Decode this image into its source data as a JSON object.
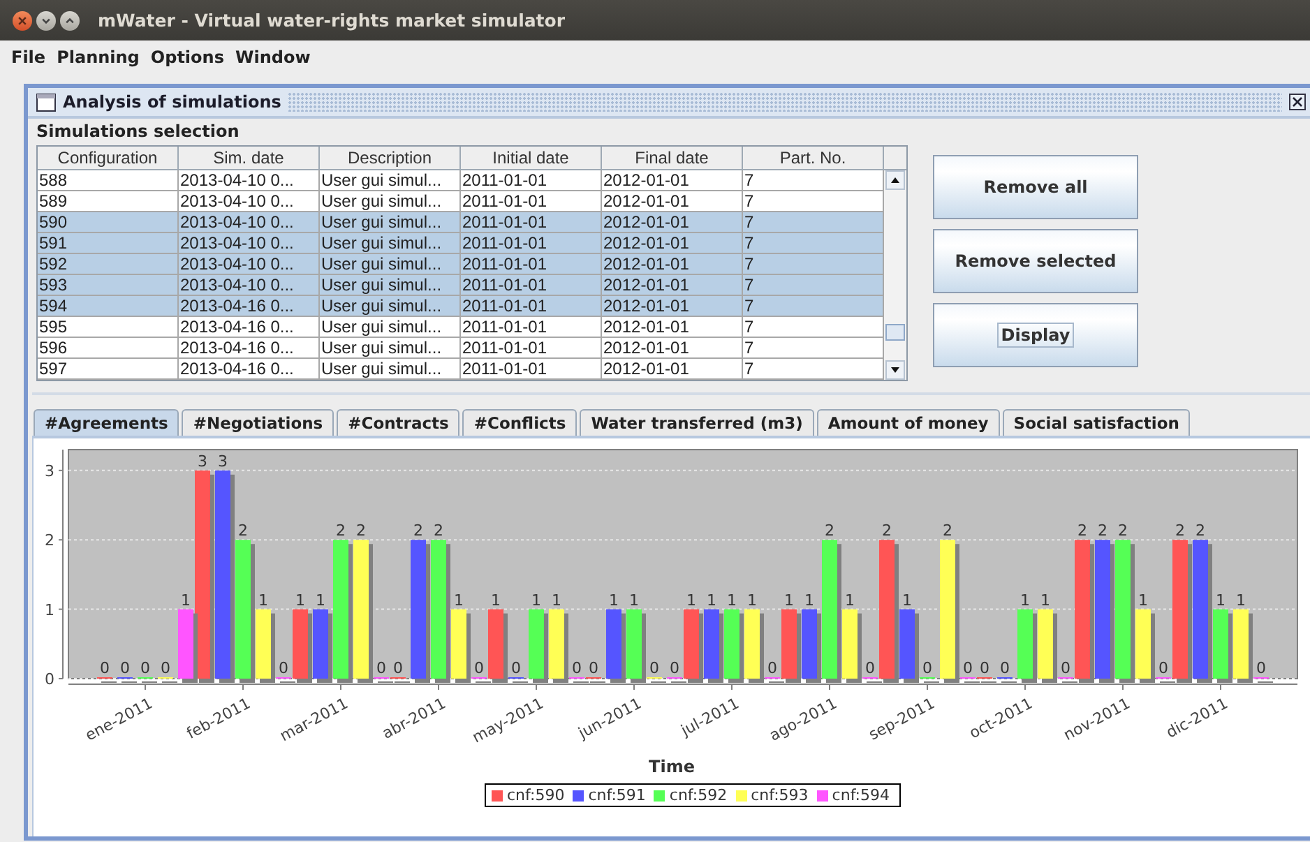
{
  "window": {
    "title": "mWater - Virtual water-rights market simulator"
  },
  "menu": [
    "File",
    "Planning",
    "Options",
    "Window"
  ],
  "internal_frame": {
    "title": "Analysis of simulations"
  },
  "selection_panel": {
    "title": "Simulations selection",
    "table": {
      "columns": [
        "Configuration",
        "Sim. date",
        "Description",
        "Initial date",
        "Final date",
        "Part. No."
      ],
      "rows": [
        {
          "cells": [
            "588",
            "2013-04-10 0...",
            "User gui simul...",
            "2011-01-01",
            "2012-01-01",
            "7"
          ],
          "selected": false
        },
        {
          "cells": [
            "589",
            "2013-04-10 0...",
            "User gui simul...",
            "2011-01-01",
            "2012-01-01",
            "7"
          ],
          "selected": false
        },
        {
          "cells": [
            "590",
            "2013-04-10 0...",
            "User gui simul...",
            "2011-01-01",
            "2012-01-01",
            "7"
          ],
          "selected": true
        },
        {
          "cells": [
            "591",
            "2013-04-10 0...",
            "User gui simul...",
            "2011-01-01",
            "2012-01-01",
            "7"
          ],
          "selected": true
        },
        {
          "cells": [
            "592",
            "2013-04-10 0...",
            "User gui simul...",
            "2011-01-01",
            "2012-01-01",
            "7"
          ],
          "selected": true
        },
        {
          "cells": [
            "593",
            "2013-04-10 0...",
            "User gui simul...",
            "2011-01-01",
            "2012-01-01",
            "7"
          ],
          "selected": true
        },
        {
          "cells": [
            "594",
            "2013-04-16 0...",
            "User gui simul...",
            "2011-01-01",
            "2012-01-01",
            "7"
          ],
          "selected": true
        },
        {
          "cells": [
            "595",
            "2013-04-16 0...",
            "User gui simul...",
            "2011-01-01",
            "2012-01-01",
            "7"
          ],
          "selected": false
        },
        {
          "cells": [
            "596",
            "2013-04-16 0...",
            "User gui simul...",
            "2011-01-01",
            "2012-01-01",
            "7"
          ],
          "selected": false
        },
        {
          "cells": [
            "597",
            "2013-04-16 0...",
            "User gui simul...",
            "2011-01-01",
            "2012-01-01",
            "7"
          ],
          "selected": false
        }
      ]
    },
    "buttons": [
      {
        "label": "Remove all",
        "focused": false
      },
      {
        "label": "Remove selected",
        "focused": false
      },
      {
        "label": "Display",
        "focused": true
      }
    ]
  },
  "tabs": [
    {
      "label": "#Agreements",
      "selected": true
    },
    {
      "label": "#Negotiations",
      "selected": false
    },
    {
      "label": "#Contracts",
      "selected": false
    },
    {
      "label": "#Conflicts",
      "selected": false
    },
    {
      "label": "Water transferred (m3)",
      "selected": false
    },
    {
      "label": "Amount of money",
      "selected": false
    },
    {
      "label": "Social satisfaction",
      "selected": false
    }
  ],
  "chart_data": {
    "type": "bar",
    "xlabel": "Time",
    "categories": [
      "ene-2011",
      "feb-2011",
      "mar-2011",
      "abr-2011",
      "may-2011",
      "jun-2011",
      "jul-2011",
      "ago-2011",
      "sep-2011",
      "oct-2011",
      "nov-2011",
      "dic-2011"
    ],
    "series": [
      {
        "name": "cnf:590",
        "color": "#ff5555",
        "values": [
          0,
          3,
          1,
          0,
          1,
          0,
          1,
          1,
          2,
          0,
          2,
          2
        ]
      },
      {
        "name": "cnf:591",
        "color": "#5555ff",
        "values": [
          0,
          3,
          1,
          2,
          0,
          1,
          1,
          1,
          1,
          0,
          2,
          2
        ]
      },
      {
        "name": "cnf:592",
        "color": "#55ff55",
        "values": [
          0,
          2,
          2,
          2,
          1,
          1,
          1,
          2,
          0,
          1,
          2,
          1
        ]
      },
      {
        "name": "cnf:593",
        "color": "#ffff55",
        "values": [
          0,
          1,
          2,
          1,
          1,
          0,
          1,
          1,
          2,
          1,
          1,
          1
        ]
      },
      {
        "name": "cnf:594",
        "color": "#ff55ff",
        "values": [
          1,
          0,
          0,
          0,
          0,
          0,
          0,
          0,
          0,
          0,
          0,
          0
        ]
      }
    ],
    "ylim": [
      0,
      3.3
    ],
    "yticks": [
      0,
      1,
      2,
      3
    ],
    "data_labels": true,
    "grid": true,
    "legend": true
  }
}
